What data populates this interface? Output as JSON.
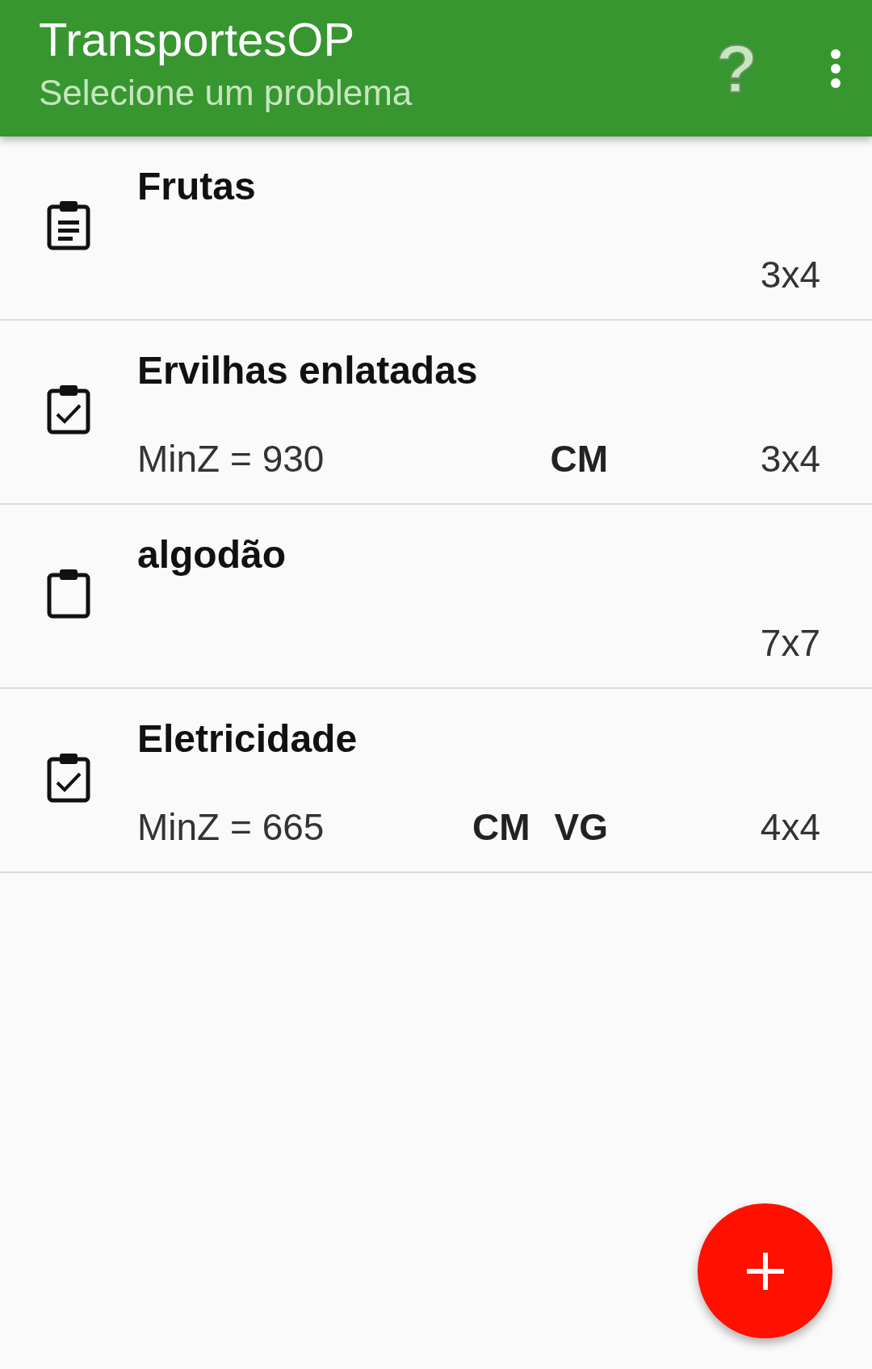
{
  "app_bar": {
    "title": "TransportesOP",
    "subtitle": "Selecione um problema",
    "help_glyph": "?"
  },
  "problems": [
    {
      "name": "Frutas",
      "kind": "list",
      "size": "3x4"
    },
    {
      "name": "Ervilhas enlatadas",
      "kind": "check",
      "min": "MinZ = 930",
      "tags": [
        "CM"
      ],
      "size": "3x4"
    },
    {
      "name": "algodão",
      "kind": "empty",
      "size": "7x7"
    },
    {
      "name": "Eletricidade",
      "kind": "check",
      "min": "MinZ = 665",
      "tags": [
        "CM",
        "VG"
      ],
      "size": "4x4"
    }
  ]
}
